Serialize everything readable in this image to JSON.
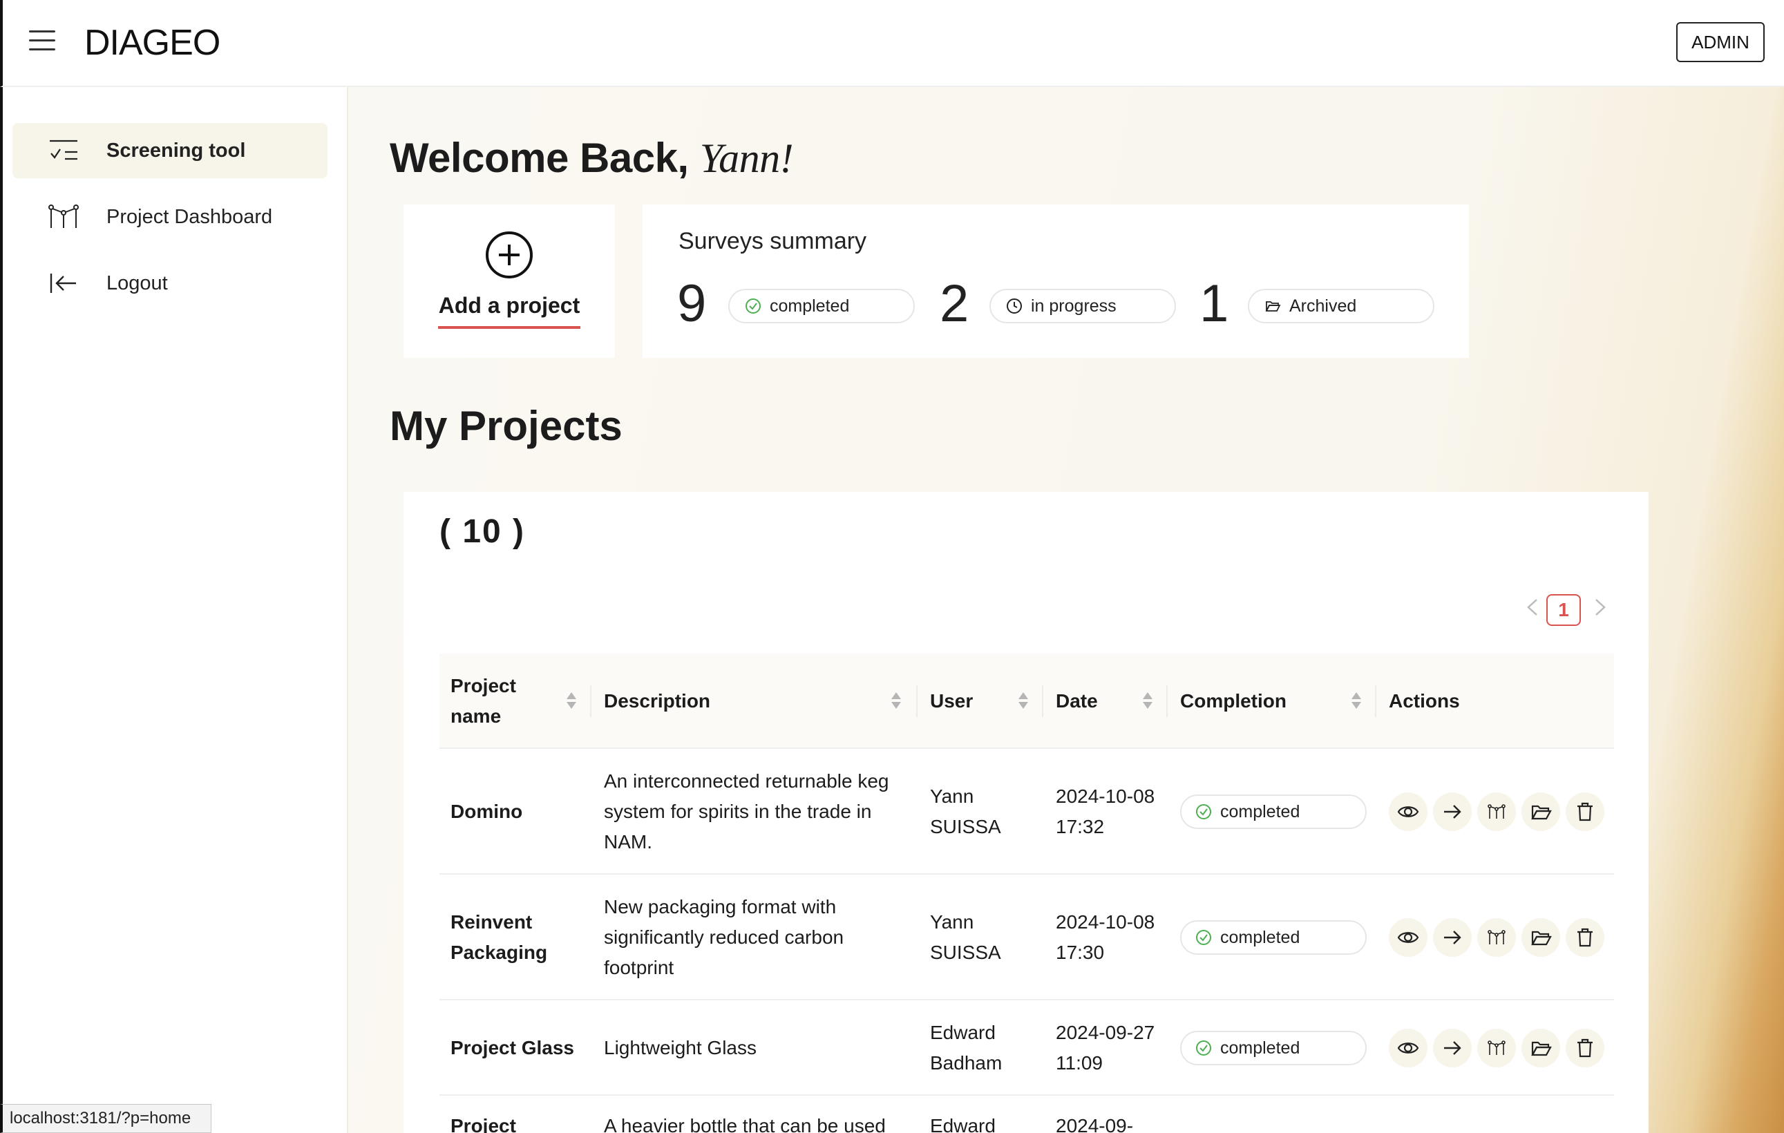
{
  "header": {
    "logo_text": "DIAGEO",
    "admin_label": "ADMIN",
    "menu_icon": "hamburger-menu-icon"
  },
  "sidebar": {
    "items": [
      {
        "label": "Screening tool",
        "icon": "checklist-icon",
        "active": true
      },
      {
        "label": "Project Dashboard",
        "icon": "branch-network-icon",
        "active": false
      },
      {
        "label": "Logout",
        "icon": "logout-arrow-icon",
        "active": false
      }
    ]
  },
  "welcome": {
    "prefix": "Welcome Back,",
    "name": "Yann!"
  },
  "add_project": {
    "label": "Add a project",
    "icon": "plus-circle-icon"
  },
  "summary": {
    "title": "Surveys summary",
    "items": [
      {
        "count": "9",
        "label": "completed",
        "icon": "check-circle-icon"
      },
      {
        "count": "2",
        "label": "in progress",
        "icon": "clock-icon"
      },
      {
        "count": "1",
        "label": "Archived",
        "icon": "folder-open-icon"
      }
    ]
  },
  "projects": {
    "title": "My Projects",
    "count": "( 10 )",
    "pagination": {
      "current_page": "1"
    },
    "columns": [
      "Project name",
      "Description",
      "User",
      "Date",
      "Completion",
      "Actions"
    ],
    "rows": [
      {
        "name": "Domino",
        "description": "An interconnected returnable keg system for spirits in the trade in NAM.",
        "user": "Yann SUISSA",
        "date": "2024-10-08 17:32",
        "completion": "completed"
      },
      {
        "name": "Reinvent Packaging",
        "description": "New packaging format with significantly reduced carbon footprint",
        "user": "Yann SUISSA",
        "date": "2024-10-08 17:30",
        "completion": "completed"
      },
      {
        "name": "Project Glass",
        "description": "Lightweight Glass",
        "user": "Edward Badham",
        "date": "2024-09-27 11:09",
        "completion": "completed"
      },
      {
        "name": "Project",
        "description": "A heavier bottle that can be used",
        "user": "Edward",
        "date": "2024-09-",
        "completion": ""
      }
    ],
    "action_icons": [
      "eye-icon",
      "arrow-right-icon",
      "branch-network-icon",
      "folder-open-icon",
      "trash-icon"
    ]
  },
  "colors": {
    "accent": "#d9534f",
    "success": "#4caf50",
    "active_nav_bg": "#f7f4ea"
  },
  "status_bar": {
    "url": "localhost:3181/?p=home"
  }
}
